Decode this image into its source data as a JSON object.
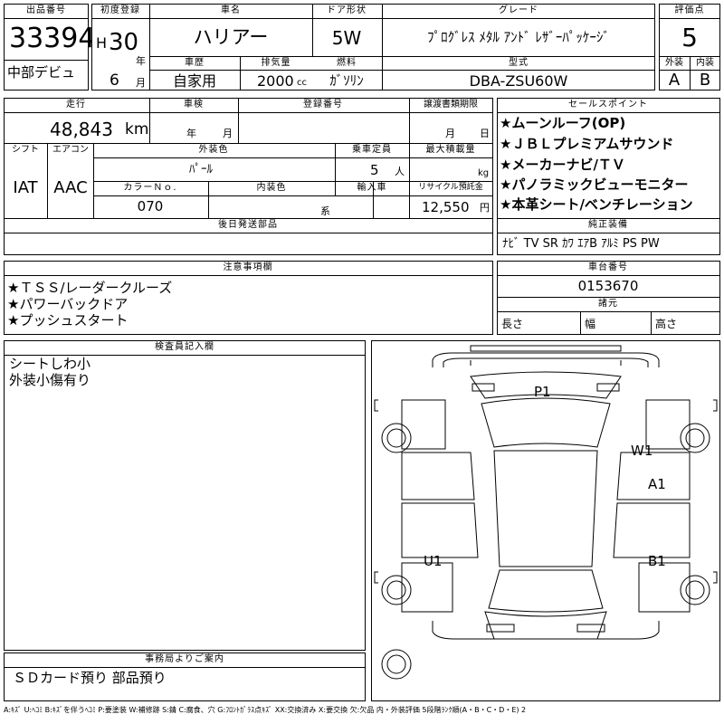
{
  "header": {
    "lot_label": "出品番号",
    "lot_no": "33394",
    "venue": "中部デビュ",
    "first_reg_label": "初度登録",
    "era": "H",
    "year": "30",
    "year_unit": "年",
    "month": "6",
    "month_unit": "月",
    "car_name_label": "車名",
    "car_name": "ハリアー",
    "door_label": "ドア形状",
    "door": "5W",
    "grade_label": "グレード",
    "grade": "ﾌﾟﾛｸﾞﾚｽ ﾒﾀﾙ ｱﾝﾄﾞ ﾚｻﾞｰﾊﾟｯｹｰｼﾞ",
    "history_label": "車歴",
    "history": "自家用",
    "displacement_label": "排気量",
    "displacement": "2000",
    "displacement_unit": "cc",
    "fuel_label": "燃料",
    "fuel": "ｶﾞｿﾘﾝ",
    "model_label": "型式",
    "model": "DBA-ZSU60W",
    "score_label": "評価点",
    "score": "5",
    "ext_label": "外装",
    "ext": "A",
    "int_label": "内装",
    "int": "B"
  },
  "specs": {
    "mileage_label": "走行",
    "mileage": "48,843",
    "mileage_unit": "km",
    "inspection_label": "車検",
    "insp_year_unit": "年",
    "insp_month_unit": "月",
    "reg_no_label": "登録番号",
    "transfer_label": "譲渡書類期限",
    "transfer_month_unit": "月",
    "transfer_day_unit": "日",
    "shift_label": "シフト",
    "shift": "IAT",
    "ac_label": "エアコン",
    "ac": "AAC",
    "ext_color_label": "外装色",
    "ext_color": "ﾊﾟｰﾙ",
    "capacity_label": "乗車定員",
    "capacity": "5",
    "capacity_unit": "人",
    "load_label": "最大積載量",
    "load_unit": "kg",
    "color_no_label": "カラーＮｏ.",
    "color_no": "070",
    "int_color_label": "内装色",
    "int_color_unit": "系",
    "import_label": "輸入車",
    "recycle_label": "リサイクル預託金",
    "recycle": "12,550",
    "recycle_unit": "円",
    "later_parts_label": "後日発送部品"
  },
  "sales": {
    "label": "セールスポイント",
    "items": [
      "★ムーンルーフ(OP)",
      "★ＪＢＬプレミアムサウンド",
      "★メーカーナビ/ＴＶ",
      "★パノラミックビューモニター",
      "★本革シート/ベンチレーション"
    ],
    "equip_label": "純正装備",
    "equip": "ﾅﾋﾞ TV SR ｶﾜ ｴｱB ｱﾙﾐ PS PW"
  },
  "notes": {
    "label": "注意事項欄",
    "items": [
      "★ＴＳＳ/レーダークルーズ",
      "★パワーバックドア",
      "★プッシュスタート"
    ]
  },
  "chassis": {
    "label": "車台番号",
    "number": "0153670",
    "dims_label": "諸元",
    "length_label": "長さ",
    "width_label": "幅",
    "height_label": "高さ"
  },
  "inspector": {
    "label": "検査員記入欄",
    "lines": [
      "シートしわ小",
      "外装小傷有り"
    ]
  },
  "office": {
    "label": "事務局よりご案内",
    "text": "ＳＤカード預り 部品預り"
  },
  "diagram": {
    "marks": [
      "P1",
      "W1",
      "A1",
      "U1",
      "B1"
    ]
  },
  "legend": "A:ｷｽﾞ U:ﾍｺﾐ B:ｷｽﾞを伴うﾍｺﾐ P:要塗装 W:補修跡 S:錆 C:腐食、穴 G:ﾌﾛﾝﾄｶﾞﾗｽ点ｷｽﾞ XX:交換済み X:要交換 欠:欠品 内・外装評価 5段階ﾗﾝｸ順(A・B・C・D・E) 2"
}
